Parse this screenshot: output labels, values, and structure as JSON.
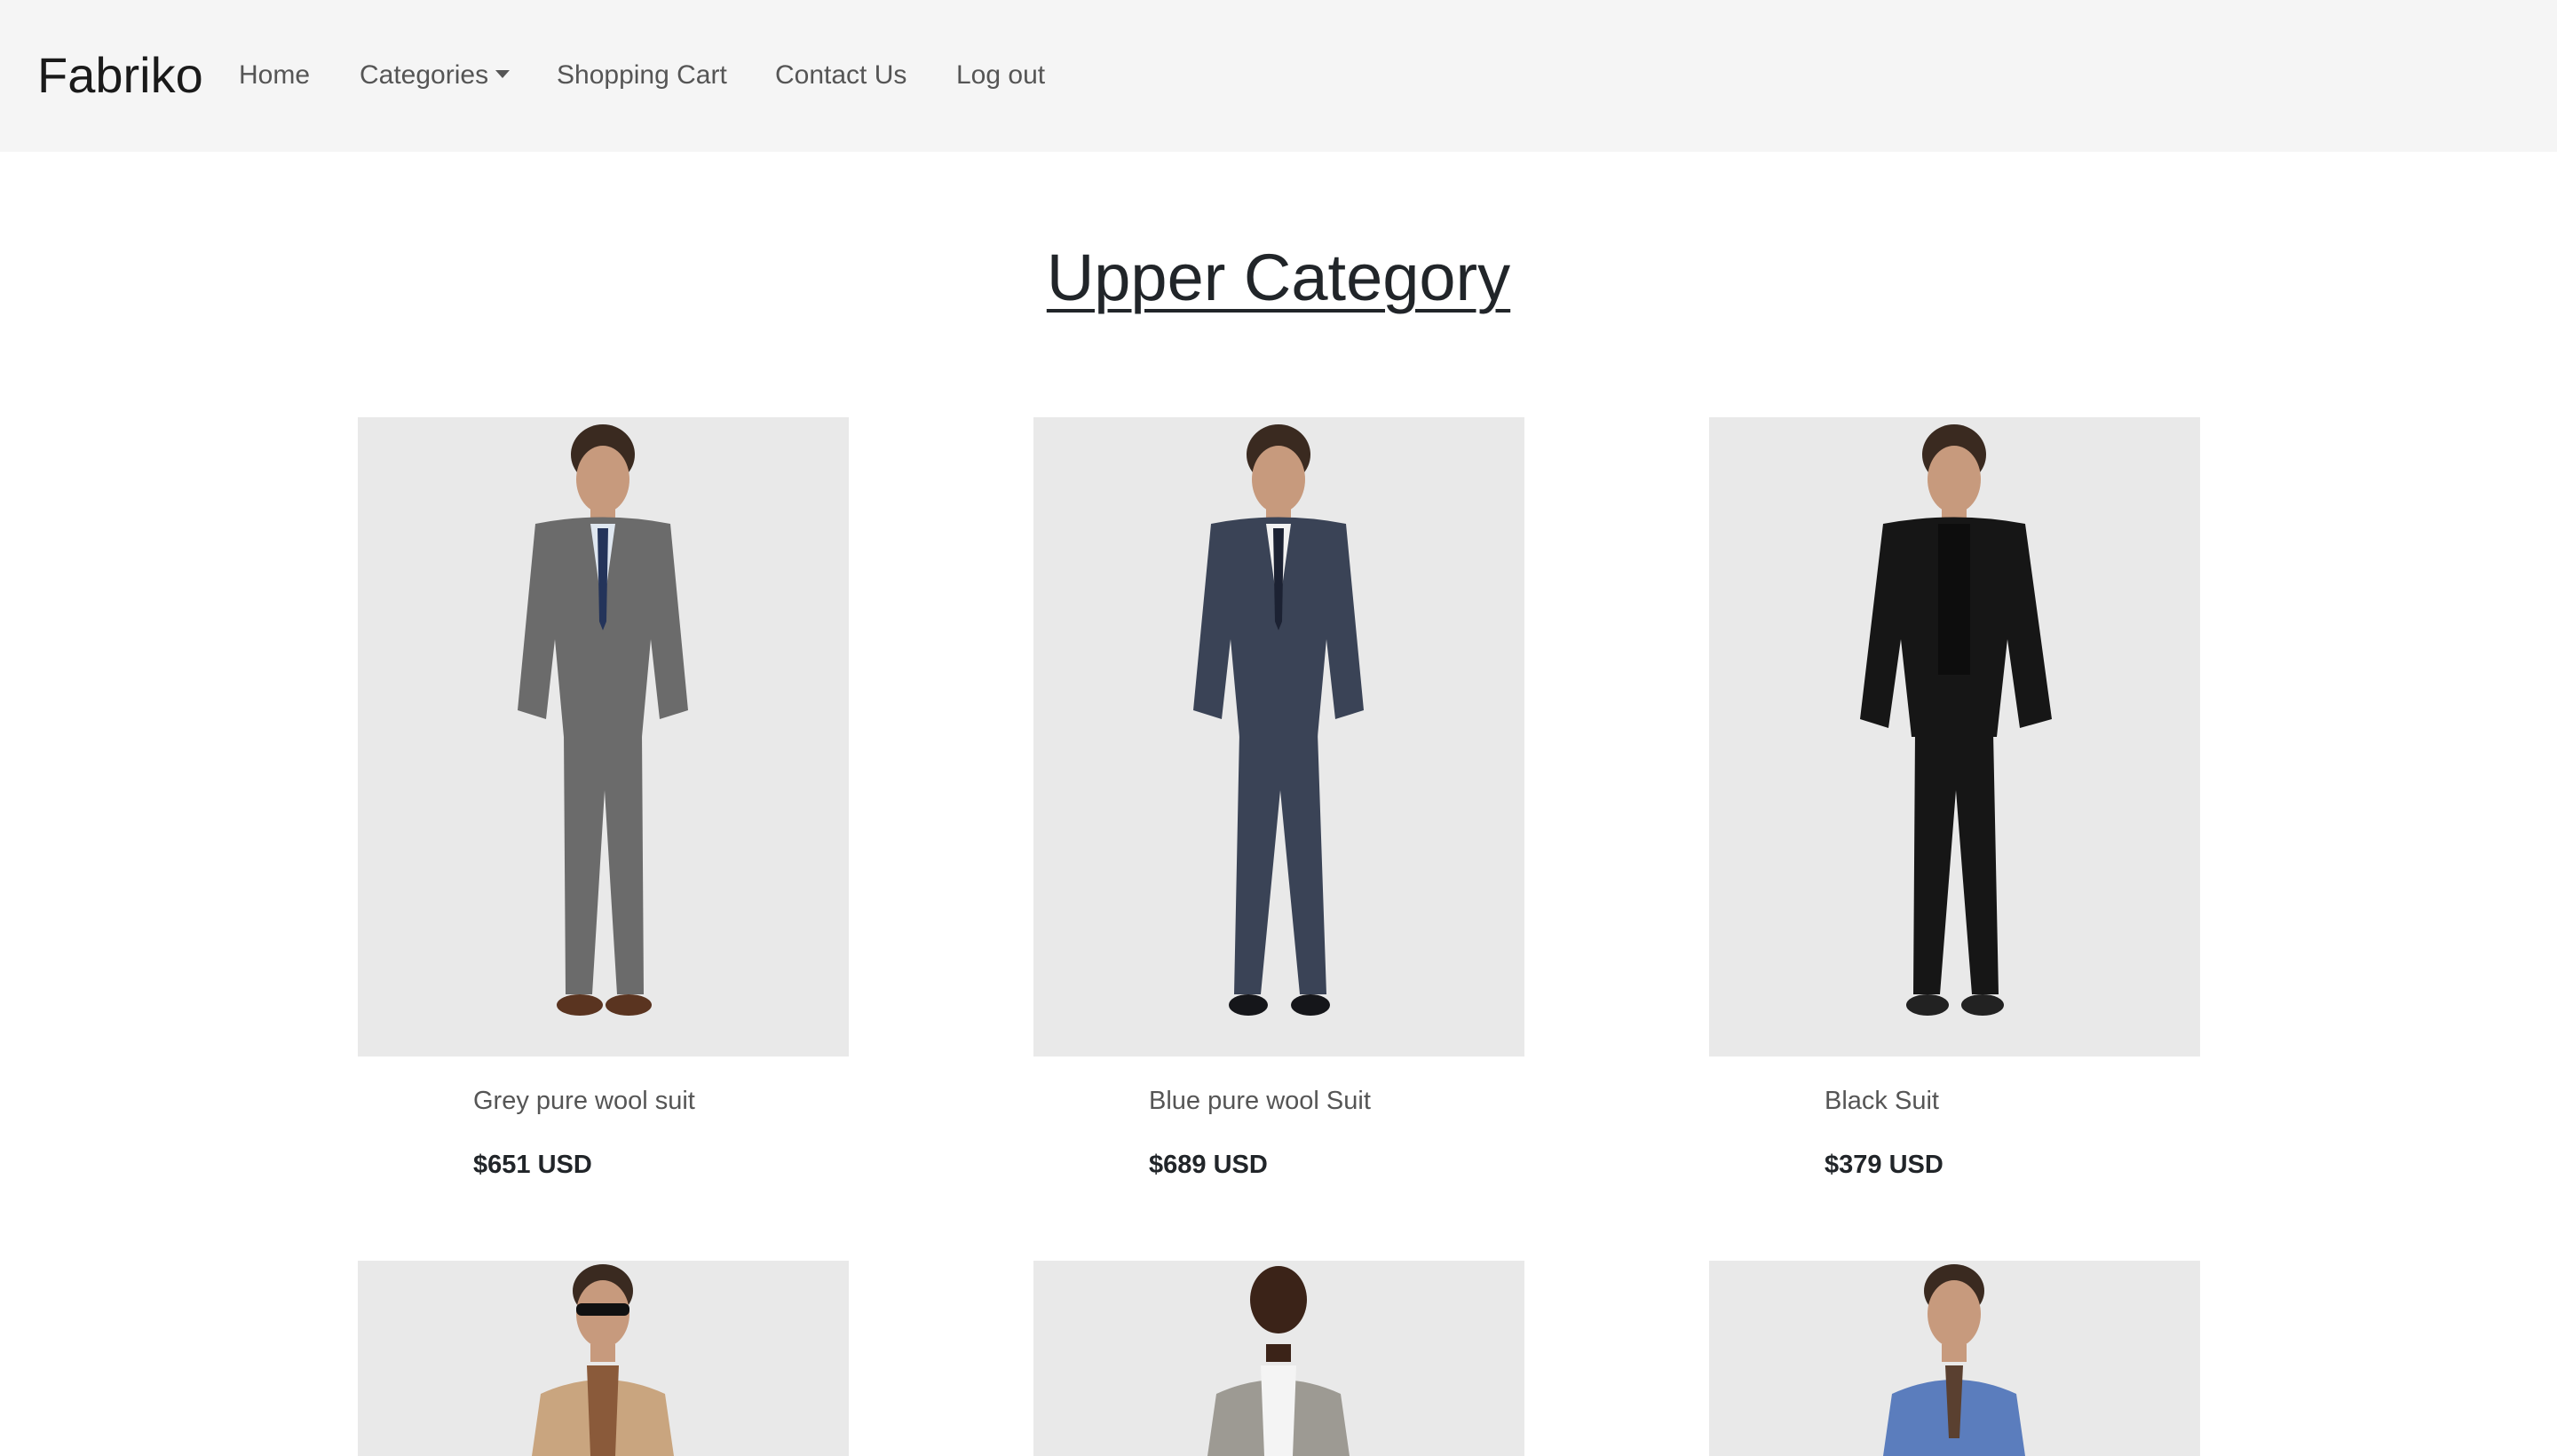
{
  "navbar": {
    "brand": "Fabriko",
    "links": [
      {
        "label": "Home"
      },
      {
        "label": "Categories",
        "has_caret": true
      },
      {
        "label": "Shopping Cart"
      },
      {
        "label": "Contact Us"
      },
      {
        "label": "Log out"
      }
    ]
  },
  "page": {
    "title": "Upper Category"
  },
  "products": [
    {
      "name": "Grey pure wool suit",
      "price": "$651 USD",
      "suit_color": "#6b6b6b"
    },
    {
      "name": "Blue pure wool Suit",
      "price": "$689 USD",
      "suit_color": "#3a4356"
    },
    {
      "name": "Black Suit",
      "price": "$379 USD",
      "suit_color": "#161616"
    },
    {
      "name": "",
      "price": "",
      "suit_color": "#c9a57f"
    },
    {
      "name": "",
      "price": "",
      "suit_color": "#9d9a93"
    },
    {
      "name": "",
      "price": "",
      "suit_color": "#5b7dbd"
    }
  ],
  "colors": {
    "navbar_bg": "#f5f5f5",
    "image_bg": "#e9e9e9",
    "text": "#212529",
    "muted": "#555555"
  }
}
